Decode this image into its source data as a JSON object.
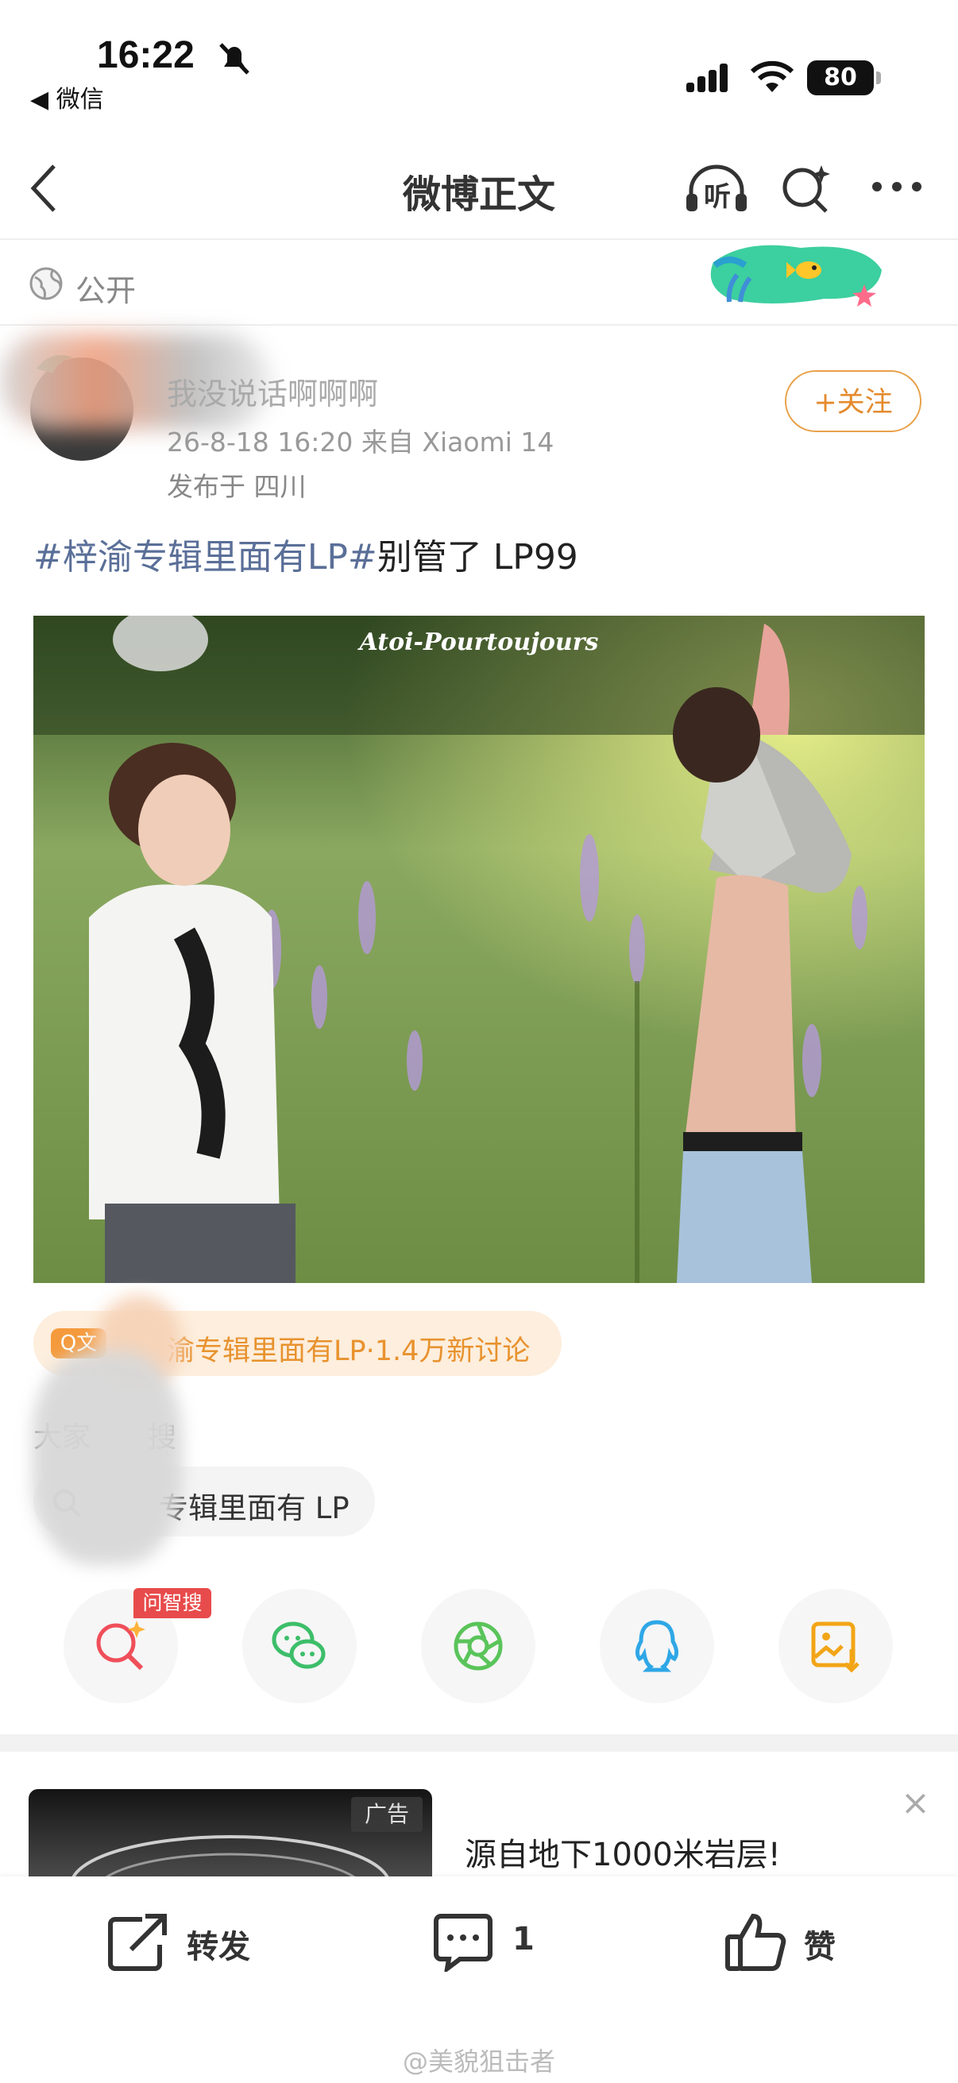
{
  "status_bar": {
    "time": "16:22",
    "back_app": "◀ 微信",
    "battery": "80"
  },
  "nav": {
    "title": "微博正文",
    "listen_label": "听"
  },
  "visibility": {
    "label": "公开"
  },
  "post": {
    "username": "我没说话啊啊啊",
    "meta": "26-8-18 16:20  来自 Xiaomi 14",
    "location": "发布于 四川",
    "follow_label": "+关注",
    "hashtag": "#梓渝专辑里面有LP#",
    "text": "别管了 LP99",
    "image_watermark": "Atoi-Pourtoujours"
  },
  "topic": {
    "icon_label": "Q文",
    "text": "渝专辑里面有LP·1.4万新讨论"
  },
  "everyone_search": {
    "label": "大家",
    "label_suffix": "搜",
    "query": "专辑里面有 LP"
  },
  "share": {
    "ask_badge": "问智搜"
  },
  "ad": {
    "badge": "广告",
    "text": "源自地下1000米岩层!",
    "close": "×"
  },
  "actions": {
    "repost_label": "转发",
    "comment_count": "1",
    "like_label": "赞"
  },
  "footer": {
    "watermark": "@美貌狙击者"
  },
  "colors": {
    "accent_orange": "#e8922e",
    "hashtag_blue": "#5a6f98",
    "badge_red": "#e84b4b"
  }
}
